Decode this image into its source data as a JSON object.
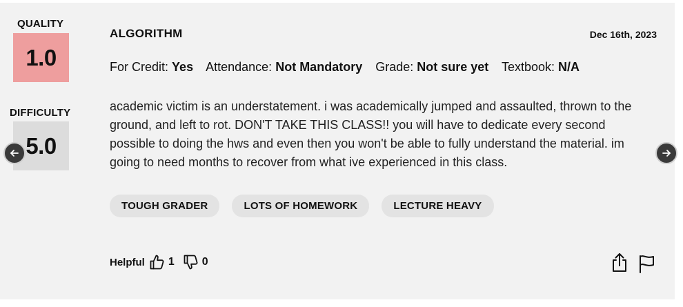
{
  "ratings": {
    "quality_label": "QUALITY",
    "quality_value": "1.0",
    "quality_color": "#ee9e9e",
    "difficulty_label": "DIFFICULTY",
    "difficulty_value": "5.0",
    "difficulty_color": "#dcdcdc"
  },
  "review": {
    "course": "ALGORITHM",
    "date": "Dec 16th, 2023",
    "meta": [
      {
        "label": "For Credit:",
        "value": "Yes"
      },
      {
        "label": "Attendance:",
        "value": "Not Mandatory"
      },
      {
        "label": "Grade:",
        "value": "Not sure yet"
      },
      {
        "label": "Textbook:",
        "value": "N/A"
      }
    ],
    "text": "academic victim is an understatement. i was academically jumped and assaulted, thrown to the ground, and left to rot. DON'T TAKE THIS CLASS!! you will have to dedicate every second possible to doing the hws and even then you won't be able to fully understand the material. im going to need months to recover from what ive experienced in this class.",
    "tags": [
      "TOUGH GRADER",
      "LOTS OF HOMEWORK",
      "LECTURE HEAVY"
    ]
  },
  "footer": {
    "helpful_label": "Helpful",
    "thumbs_up_count": "1",
    "thumbs_down_count": "0"
  },
  "icons": {
    "thumbs_up": "thumbs-up-icon",
    "thumbs_down": "thumbs-down-icon",
    "share": "share-icon",
    "flag": "flag-icon",
    "prev": "arrow-left-icon",
    "next": "arrow-right-icon"
  }
}
